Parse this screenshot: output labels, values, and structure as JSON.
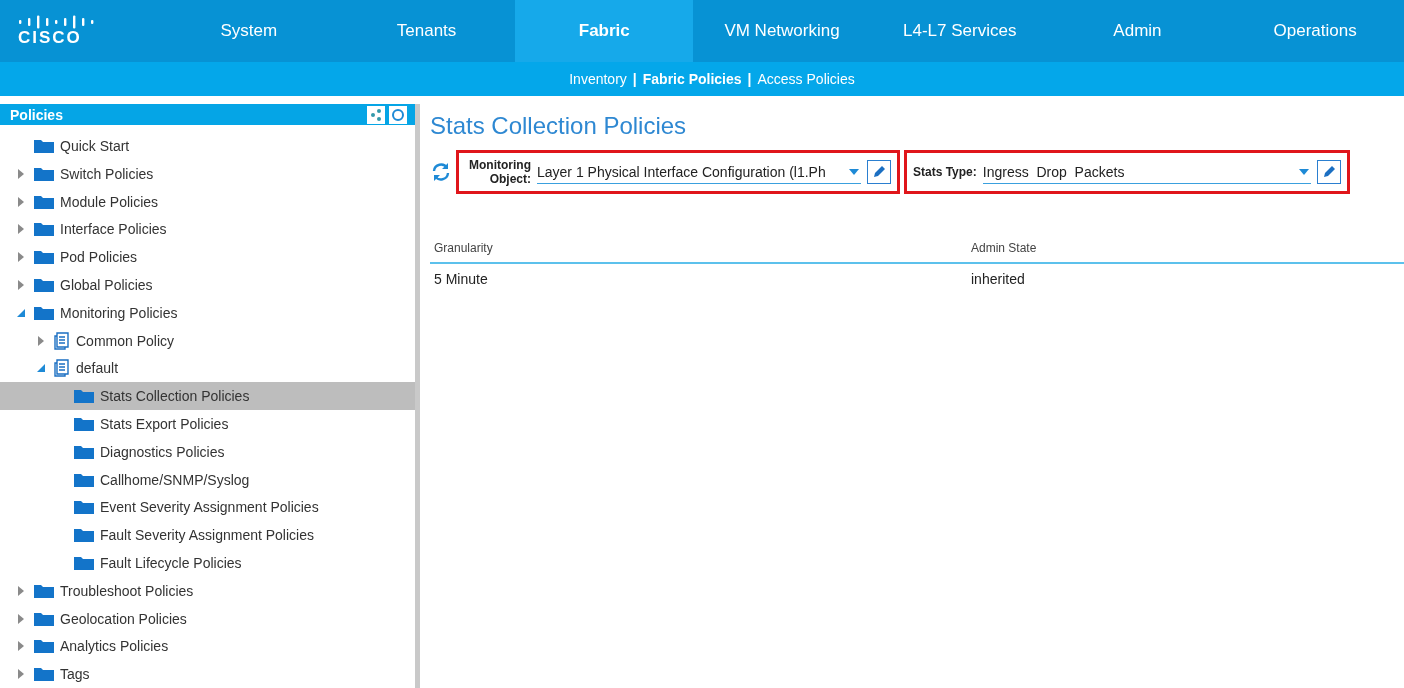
{
  "logo": {
    "wordmark": "CISCO"
  },
  "nav_tabs": [
    {
      "label": "System",
      "selected": false
    },
    {
      "label": "Tenants",
      "selected": false
    },
    {
      "label": "Fabric",
      "selected": true
    },
    {
      "label": "VM Networking",
      "selected": false
    },
    {
      "label": "L4-L7 Services",
      "selected": false
    },
    {
      "label": "Admin",
      "selected": false
    },
    {
      "label": "Operations",
      "selected": false
    }
  ],
  "sub_nav": {
    "separator": "|",
    "items": [
      {
        "label": "Inventory",
        "selected": false
      },
      {
        "label": "Fabric Policies",
        "selected": true
      },
      {
        "label": "Access Policies",
        "selected": false
      }
    ]
  },
  "sidebar": {
    "title": "Policies",
    "tree": [
      {
        "label": "Quick Start",
        "kind": "folder",
        "selected": false
      },
      {
        "label": "Switch Policies",
        "kind": "folder",
        "expanded": false,
        "selected": false
      },
      {
        "label": "Module Policies",
        "kind": "folder",
        "expanded": false,
        "selected": false
      },
      {
        "label": "Interface Policies",
        "kind": "folder",
        "expanded": false,
        "selected": false
      },
      {
        "label": "Pod Policies",
        "kind": "folder",
        "expanded": false,
        "selected": false
      },
      {
        "label": "Global Policies",
        "kind": "folder",
        "expanded": false,
        "selected": false
      },
      {
        "label": "Monitoring Policies",
        "kind": "folder",
        "expanded": true,
        "selected": false,
        "children": [
          {
            "label": "Common Policy",
            "kind": "policy",
            "expanded": false,
            "selected": false
          },
          {
            "label": "default",
            "kind": "policy",
            "expanded": true,
            "selected": false,
            "children": [
              {
                "label": "Stats Collection Policies",
                "kind": "folder",
                "selected": true
              },
              {
                "label": "Stats Export Policies",
                "kind": "folder",
                "selected": false
              },
              {
                "label": "Diagnostics Policies",
                "kind": "folder",
                "selected": false
              },
              {
                "label": "Callhome/SNMP/Syslog",
                "kind": "folder",
                "selected": false
              },
              {
                "label": "Event Severity Assignment Policies",
                "kind": "folder",
                "selected": false
              },
              {
                "label": "Fault Severity Assignment Policies",
                "kind": "folder",
                "selected": false
              },
              {
                "label": "Fault Lifecycle Policies",
                "kind": "folder",
                "selected": false
              }
            ]
          }
        ]
      },
      {
        "label": "Troubleshoot Policies",
        "kind": "folder",
        "expanded": false,
        "selected": false
      },
      {
        "label": "Geolocation Policies",
        "kind": "folder",
        "expanded": false,
        "selected": false
      },
      {
        "label": "Analytics Policies",
        "kind": "folder",
        "expanded": false,
        "selected": false
      },
      {
        "label": "Tags",
        "kind": "folder",
        "expanded": false,
        "selected": false
      }
    ]
  },
  "main": {
    "title": "Stats Collection Policies",
    "filters": [
      {
        "label": "Monitoring Object:",
        "value": "Layer 1 Physical Interface Configuration (l1.Ph"
      },
      {
        "label": "Stats Type:",
        "value": "Ingress  Drop  Packets"
      }
    ],
    "table": {
      "columns": [
        "Granularity",
        "Admin State"
      ],
      "rows": [
        [
          "5 Minute",
          "inherited"
        ]
      ]
    }
  }
}
